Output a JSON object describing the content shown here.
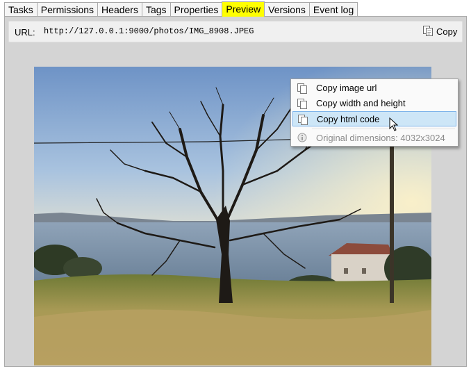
{
  "tabs": [
    {
      "label": "Tasks"
    },
    {
      "label": "Permissions"
    },
    {
      "label": "Headers"
    },
    {
      "label": "Tags"
    },
    {
      "label": "Properties"
    },
    {
      "label": "Preview"
    },
    {
      "label": "Versions"
    },
    {
      "label": "Event log"
    }
  ],
  "active_tab": "Preview",
  "url_bar": {
    "label": "URL:",
    "value": "http://127.0.0.1:9000/photos/IMG_8908.JPEG",
    "copy_label": "Copy",
    "copy_icon": "copy-icon"
  },
  "context_menu": {
    "items": [
      {
        "label": "Copy image url",
        "icon": "copy-icon"
      },
      {
        "label": "Copy width and height",
        "icon": "copy-icon"
      },
      {
        "label": "Copy html code",
        "icon": "copy-icon",
        "highlighted": true
      }
    ],
    "info": {
      "label": "Original dimensions: 4032x3024",
      "icon": "info-icon"
    }
  },
  "colors": {
    "active_tab": "#ffff00",
    "highlight_bg": "#cde6f7",
    "highlight_border": "#7eb4ea",
    "panel_bg": "#d4d4d4"
  }
}
